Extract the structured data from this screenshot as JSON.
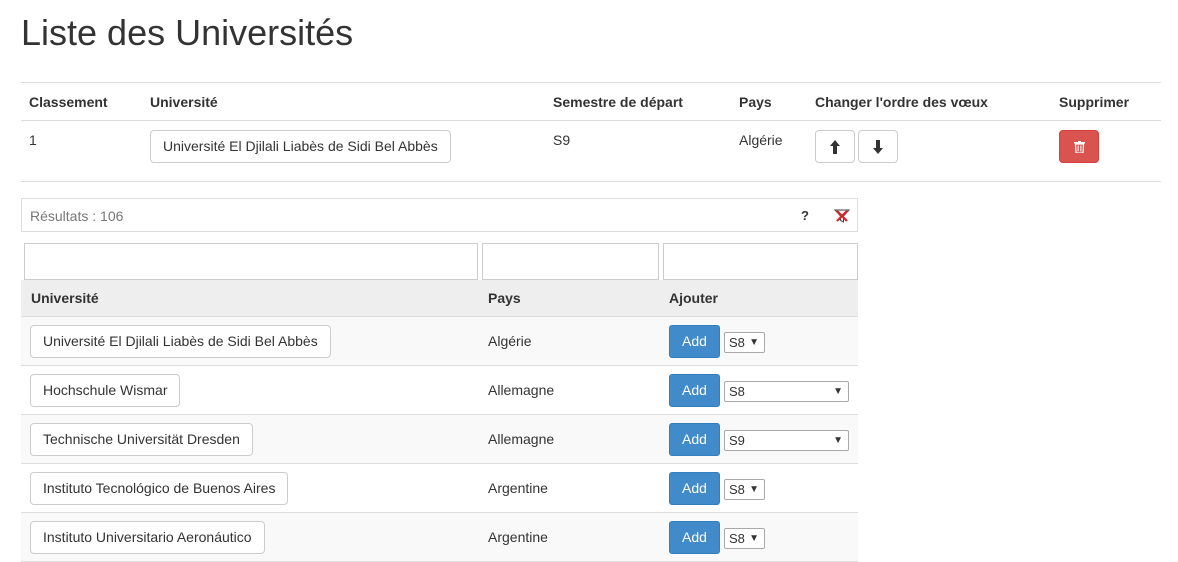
{
  "page": {
    "title": "Liste des Universités"
  },
  "choices": {
    "headers": {
      "rank": "Classement",
      "university": "Université",
      "semester": "Semestre de départ",
      "country": "Pays",
      "order": "Changer l'ordre des vœux",
      "delete": "Supprimer"
    },
    "rows": [
      {
        "rank": "1",
        "university": "Université El Djilali Liabès de Sidi Bel Abbès",
        "semester": "S9",
        "country": "Algérie",
        "up_icon": "arrow-up-icon",
        "down_icon": "arrow-down-icon",
        "delete_icon": "trash-icon",
        "delete_color": "#d9534f"
      }
    ]
  },
  "results": {
    "count_text": "Résultats : 106",
    "help_label": "?",
    "clear_icon": "clear-filter-icon",
    "headers": {
      "university": "Université",
      "country": "Pays",
      "add": "Ajouter"
    },
    "add_color": "#428bca",
    "rows": [
      {
        "university": "Université El Djilali Liabès de Sidi Bel Abbès",
        "country": "Algérie",
        "add_label": "Add",
        "semester": "S8"
      },
      {
        "university": "Hochschule Wismar",
        "country": "Allemagne",
        "add_label": "Add",
        "semester": "S8"
      },
      {
        "university": "Technische Universität Dresden",
        "country": "Allemagne",
        "add_label": "Add",
        "semester": "S9"
      },
      {
        "university": "Instituto Tecnológico de Buenos Aires",
        "country": "Argentine",
        "add_label": "Add",
        "semester": "S8"
      },
      {
        "university": "Instituto Universitario Aeronáutico",
        "country": "Argentine",
        "add_label": "Add",
        "semester": "S8"
      }
    ]
  }
}
